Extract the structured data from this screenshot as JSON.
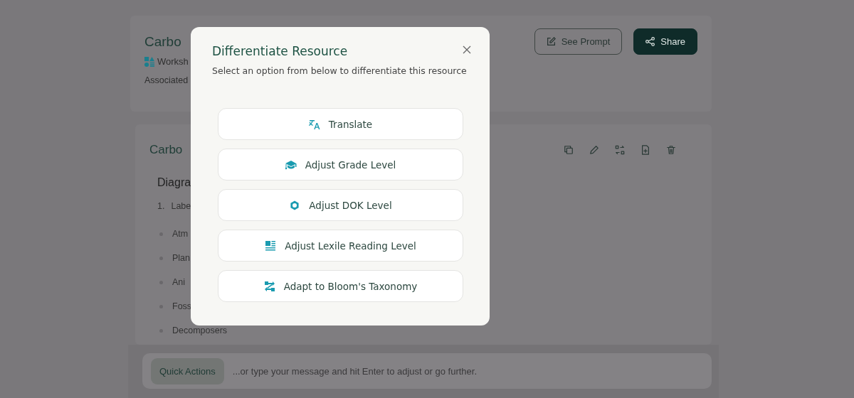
{
  "page": {
    "header": {
      "title": "Carbo",
      "type_label": "Worksh",
      "associated_label": "Associated",
      "buttons": [
        {
          "label": "See Prompt",
          "kind": "outline"
        },
        {
          "label": "Share",
          "kind": "primary"
        }
      ]
    },
    "content": {
      "title": "Carbo",
      "heading": "Diagra",
      "numbered_item": {
        "number": "1.",
        "text": "Labe"
      },
      "bullets": [
        "Atm",
        "Plan",
        "Ani",
        "Foss",
        "Decomposers"
      ]
    },
    "chat": {
      "quick_actions": "Quick Actions",
      "placeholder": "...or type your message and hit Enter to adjust or go further."
    }
  },
  "modal": {
    "title": "Differentiate Resource",
    "subtitle": "Select an option from below to differentiate this resource",
    "options": [
      {
        "label": "Translate",
        "kind": "translate"
      },
      {
        "label": "Adjust Grade Level",
        "kind": "grade"
      },
      {
        "label": "Adjust DOK Level",
        "kind": "dok"
      },
      {
        "label": "Adjust Lexile Reading Level",
        "kind": "lexile"
      },
      {
        "label": "Adapt to Bloom's Taxonomy",
        "kind": "bloom"
      }
    ]
  }
}
